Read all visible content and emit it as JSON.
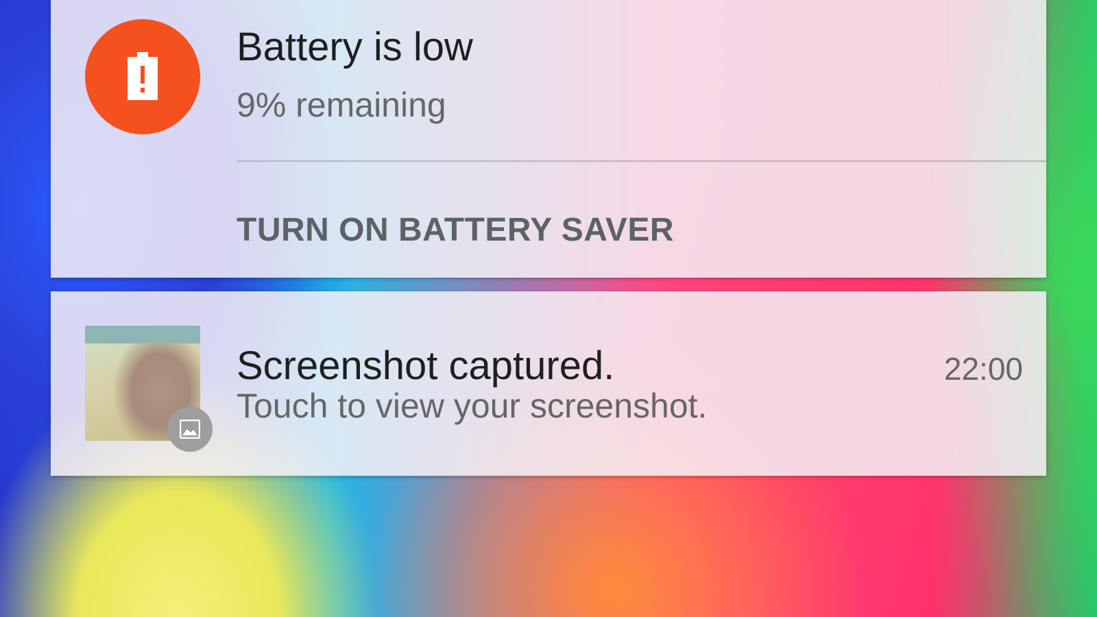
{
  "colors": {
    "battery_accent": "#f4511e",
    "card_background": "#f6f0f6",
    "action_text": "#5c6266"
  },
  "notifications": [
    {
      "icon": "battery-alert-icon",
      "title": "Battery is low",
      "subtitle": "9% remaining",
      "action_label": "TURN ON BATTERY SAVER"
    },
    {
      "icon": "screenshot-thumbnail",
      "badge_icon": "image-icon",
      "title": "Screenshot captured.",
      "subtitle": "Touch to view your screenshot.",
      "time": "22:00"
    }
  ]
}
